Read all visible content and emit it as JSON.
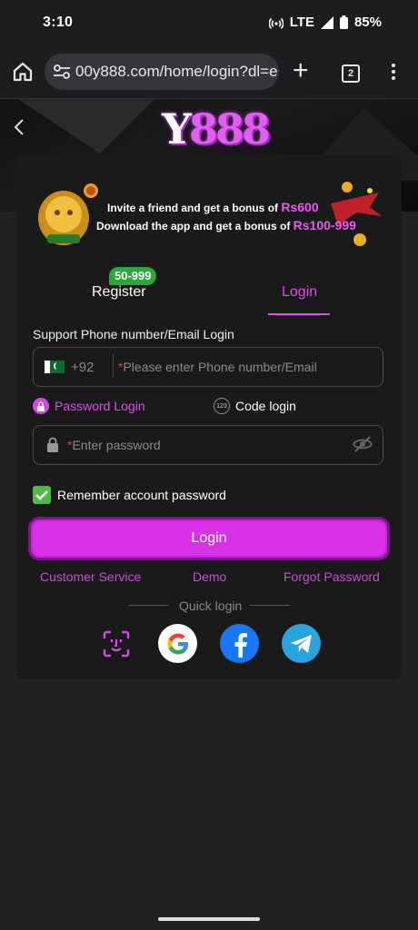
{
  "status_bar": {
    "time": "3:10",
    "network": "LTE",
    "battery": "85%"
  },
  "browser": {
    "url": "00y888.com/home/login?dl=e",
    "tab_count": "2"
  },
  "logo": {
    "y": "Y",
    "digits": "888"
  },
  "banner": {
    "line1_prefix": "Invite a friend and get a bonus of ",
    "line1_amount": "Rs600",
    "line2_prefix": "Download the app and get a bonus of ",
    "line2_amount": "Rs100-999"
  },
  "tabs": {
    "register": "Register",
    "register_badge": "50-999",
    "login": "Login",
    "active": "login"
  },
  "form": {
    "support_label": "Support Phone number/Email Login",
    "dial_code": "+92",
    "required_mark": "*",
    "phone_placeholder": "Please enter Phone number/Email",
    "password_login": "Password Login",
    "code_login": "Code login",
    "code_badge": "123",
    "password_placeholder": "Enter password",
    "remember_label": "Remember account password",
    "remember_checked": true,
    "login_button": "Login"
  },
  "links": {
    "customer_service": "Customer Service",
    "demo": "Demo",
    "forgot_password": "Forgot Password"
  },
  "quick_login": {
    "label": "Quick login",
    "providers": [
      "face-id",
      "google",
      "facebook",
      "telegram"
    ]
  },
  "colors": {
    "accent": "#d730e6",
    "badge_green": "#2ca63c",
    "checkbox_green": "#4fb848",
    "facebook": "#1877f2",
    "telegram": "#2aa3df"
  }
}
